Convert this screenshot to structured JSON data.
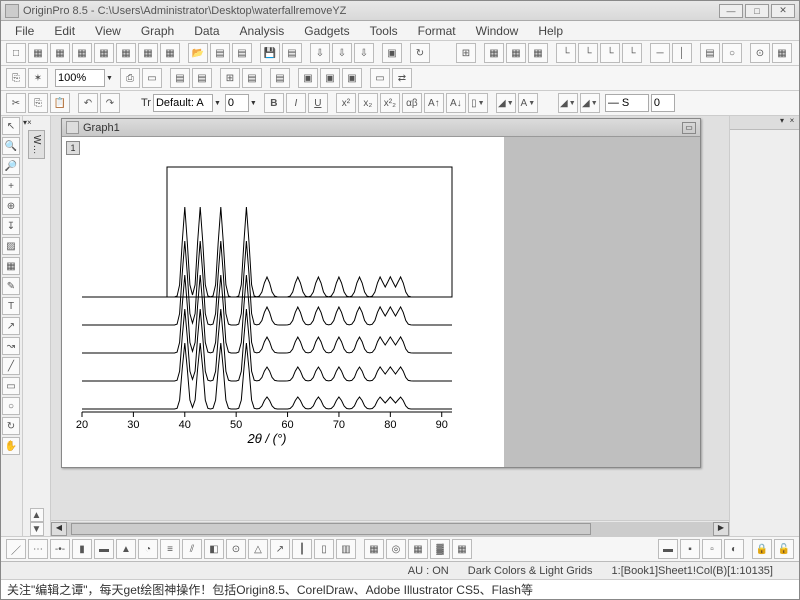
{
  "title": "OriginPro 8.5 - C:\\Users\\Administrator\\Desktop\\waterfallremoveYZ",
  "menu": [
    "File",
    "Edit",
    "View",
    "Graph",
    "Data",
    "Analysis",
    "Gadgets",
    "Tools",
    "Format",
    "Window",
    "Help"
  ],
  "toolbar2": {
    "zoom": "100%"
  },
  "toolbar3": {
    "font": "Default: A",
    "fontsize": "0",
    "linestyle": "— S",
    "linewidth": "0"
  },
  "graph": {
    "title": "Graph1",
    "layer": "1",
    "xlabel": "2θ / (°)",
    "xticks": [
      "20",
      "30",
      "40",
      "50",
      "60",
      "70",
      "80",
      "90"
    ]
  },
  "status": {
    "au": "AU : ON",
    "theme": "Dark Colors & Light Grids",
    "dataset": "1:[Book1]Sheet1!Col(B)[1:10135]"
  },
  "footer": "关注\"编辑之谭\"，每天get绘图神操作！包括Origin8.5、CorelDraw、Adobe Illustrator CS5、Flash等",
  "chart_data": {
    "type": "line",
    "title": "",
    "xlabel": "2θ / (°)",
    "ylabel": "",
    "xlim": [
      20,
      92
    ],
    "series_count": 5,
    "note": "Waterfall XRD pattern: 5 stacked diffraction traces with vertical offsets. Main peaks near 2θ ≈ 40, 43, 47, 52 (strong); weaker peaks at ≈56, 62, 66, 70, 74, 78, 80, 82.",
    "main_peaks_2theta": [
      40,
      43,
      47,
      52,
      56,
      62,
      66,
      70,
      74,
      78,
      80,
      82
    ],
    "xticks": [
      20,
      30,
      40,
      50,
      60,
      70,
      80,
      90
    ]
  }
}
